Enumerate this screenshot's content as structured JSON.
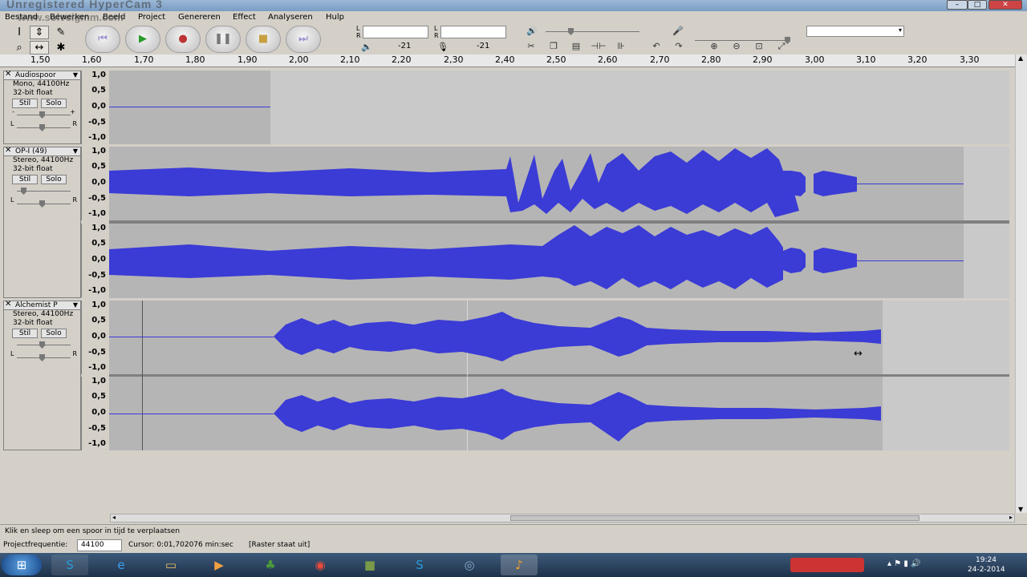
{
  "watermark": {
    "line1": "Unregistered HyperCam 3",
    "line2": "www.solveigmm.com"
  },
  "window": {
    "minimize": "–",
    "maximize": "□",
    "close": "✕"
  },
  "menu": [
    "Bestand",
    "Bewerken",
    "Beeld",
    "Project",
    "Genereren",
    "Effect",
    "Analyseren",
    "Hulp"
  ],
  "transport": {
    "skip_start": "⏮",
    "play": "▶",
    "record": "●",
    "pause": "❚❚",
    "stop": "■",
    "skip_end": "⏭"
  },
  "meters": {
    "left": "L",
    "right": "R",
    "playback_db": "-21",
    "record_db": "-21"
  },
  "ruler": {
    "ticks": [
      "1,50",
      "1,60",
      "1,70",
      "1,80",
      "1,90",
      "2,00",
      "2,10",
      "2,20",
      "2,30",
      "2,40",
      "2,50",
      "2,60",
      "2,70",
      "2,80",
      "2,90",
      "3,00",
      "3,10",
      "3,20",
      "3,30"
    ]
  },
  "tracks": [
    {
      "name": "Audiospoor",
      "format": "Mono, 44100Hz",
      "depth": "32-bit float",
      "mute": "Stil",
      "solo": "Solo",
      "pan_l": "L",
      "pan_r": "R",
      "scale": [
        "1,0",
        "0,5",
        "0,0",
        "-0,5",
        "-1,0"
      ]
    },
    {
      "name": "OP-I (49)",
      "format": "Stereo, 44100Hz",
      "depth": "32-bit float",
      "mute": "Stil",
      "solo": "Solo",
      "pan_l": "L",
      "pan_r": "R",
      "scale": [
        "1,0",
        "0,5",
        "0,0",
        "-0,5",
        "-1,0"
      ],
      "scale2": [
        "1,0",
        "0,5",
        "0,0",
        "-0,5",
        "-1,0"
      ]
    },
    {
      "name": "Alchemist P",
      "format": "Stereo, 44100Hz",
      "depth": "32-bit float",
      "mute": "Stil",
      "solo": "Solo",
      "pan_l": "L",
      "pan_r": "R",
      "scale": [
        "1,0",
        "0,5",
        "0,0",
        "-0,5",
        "-1,0"
      ],
      "scale2": [
        "1,0",
        "0,5",
        "0,0",
        "-0,5",
        "-1,0"
      ]
    }
  ],
  "status": {
    "hint": "Klik en sleep om een spoor in tijd te verplaatsen",
    "rate_label": "Projectfrequentie:",
    "rate_value": "44100",
    "cursor": "Cursor: 0:01,702076 min:sec",
    "snap": "[Raster staat uit]"
  },
  "taskbar": {
    "time": "19:24",
    "date": "24-2-2014"
  },
  "colors": {
    "wave": "#3b3bd6",
    "wave_bg": "#c9c9c9",
    "selected_bg": "#b5b5b5"
  }
}
